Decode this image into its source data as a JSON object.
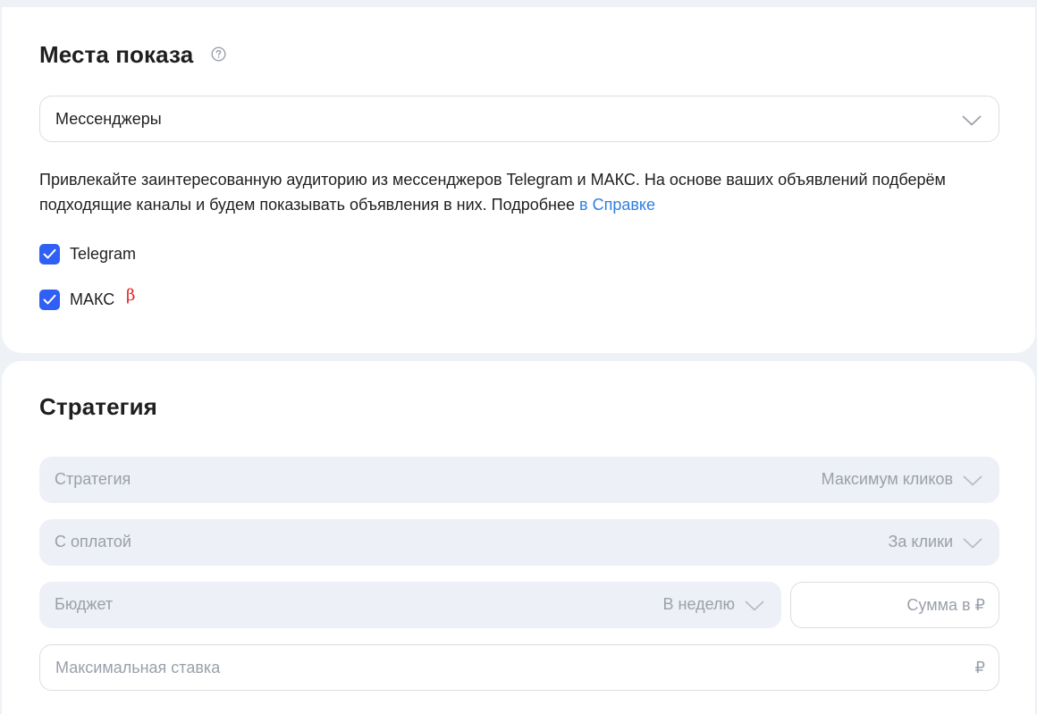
{
  "placements": {
    "title": "Места показа",
    "help_icon": "question-circle-icon",
    "select_value": "Мессенджеры",
    "description_text": "Привлекайте заинтересованную аудиторию из мессенджеров Telegram и МАКС. На основе ваших объявлений подберём подходящие каналы и будем показывать объявления в них. Подробнее ",
    "description_link": "в Справке",
    "checkboxes": [
      {
        "label": "Telegram",
        "checked": true
      },
      {
        "label": "МАКС",
        "checked": true,
        "badge": "β"
      }
    ]
  },
  "strategy": {
    "title": "Стратегия",
    "strategy_field": {
      "label": "Стратегия",
      "value": "Максимум кликов"
    },
    "payment_field": {
      "label": "С оплатой",
      "value": "За клики"
    },
    "budget_field": {
      "label": "Бюджет",
      "value": "В неделю"
    },
    "amount_field": {
      "placeholder": "Сумма в ₽"
    },
    "max_bid_field": {
      "placeholder": "Максимальная ставка",
      "currency": "₽"
    }
  },
  "colors": {
    "accent": "#2f5ff5",
    "link": "#2f7fe0",
    "beta": "#e02020",
    "filled_field": "#edf0f6"
  }
}
